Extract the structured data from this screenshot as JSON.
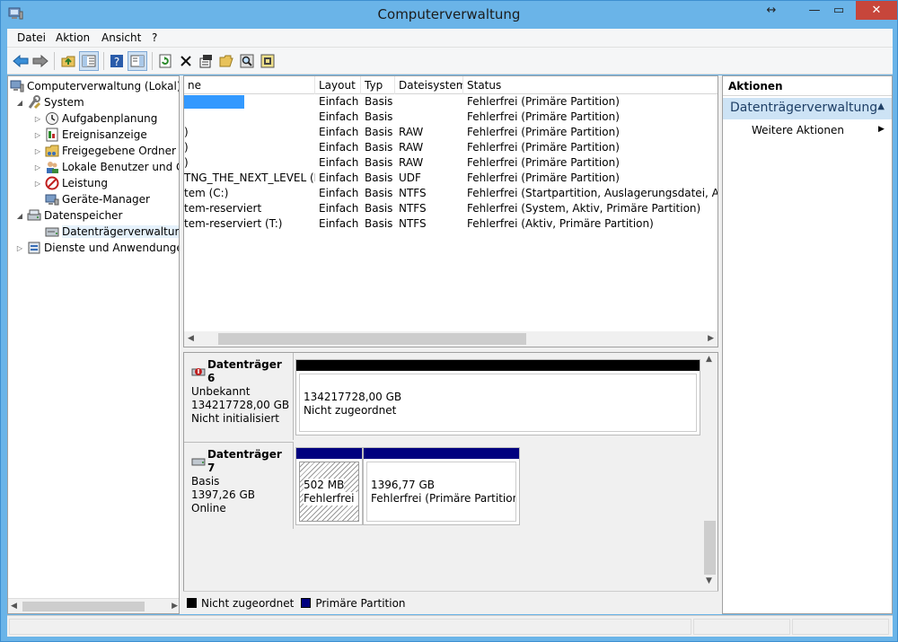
{
  "window": {
    "title": "Computerverwaltung"
  },
  "menu": [
    "Datei",
    "Aktion",
    "Ansicht",
    "?"
  ],
  "tree": {
    "root": "Computerverwaltung (Lokal)",
    "system": "System",
    "system_items": [
      "Aufgabenplanung",
      "Ereignisanzeige",
      "Freigegebene Ordner",
      "Lokale Benutzer und Gr",
      "Leistung",
      "Geräte-Manager"
    ],
    "storage": "Datenspeicher",
    "storage_items": [
      "Datenträgerverwaltung"
    ],
    "services": "Dienste und Anwendungen"
  },
  "list": {
    "columns": [
      "ne",
      "Layout",
      "Typ",
      "Dateisystem",
      "Status"
    ],
    "rows": [
      {
        "name": "",
        "layout": "Einfach",
        "type": "Basis",
        "fs": "",
        "status": "Fehlerfrei (Primäre Partition)"
      },
      {
        "name": "",
        "layout": "Einfach",
        "type": "Basis",
        "fs": "",
        "status": "Fehlerfrei (Primäre Partition)"
      },
      {
        "name": ")",
        "layout": "Einfach",
        "type": "Basis",
        "fs": "RAW",
        "status": "Fehlerfrei (Primäre Partition)"
      },
      {
        "name": ")",
        "layout": "Einfach",
        "type": "Basis",
        "fs": "RAW",
        "status": "Fehlerfrei (Primäre Partition)"
      },
      {
        "name": ")",
        "layout": "Einfach",
        "type": "Basis",
        "fs": "RAW",
        "status": "Fehlerfrei (Primäre Partition)"
      },
      {
        "name": "TNG_THE_NEXT_LEVEL (N:)",
        "layout": "Einfach",
        "type": "Basis",
        "fs": "UDF",
        "status": "Fehlerfrei (Primäre Partition)"
      },
      {
        "name": "tem (C:)",
        "layout": "Einfach",
        "type": "Basis",
        "fs": "NTFS",
        "status": "Fehlerfrei (Startpartition, Auslagerungsdatei, Absturz"
      },
      {
        "name": "tem-reserviert",
        "layout": "Einfach",
        "type": "Basis",
        "fs": "NTFS",
        "status": "Fehlerfrei (System, Aktiv, Primäre Partition)"
      },
      {
        "name": "tem-reserviert (T:)",
        "layout": "Einfach",
        "type": "Basis",
        "fs": "NTFS",
        "status": "Fehlerfrei (Aktiv, Primäre Partition)"
      }
    ]
  },
  "disks": [
    {
      "name": "Datenträger 6",
      "kind": "Unbekannt",
      "size": "134217728,00 GB",
      "state": "Nicht initialisiert",
      "volumes": [
        {
          "line1": "134217728,00 GB",
          "line2": "Nicht zugeordnet",
          "bar_color": "#000000"
        }
      ]
    },
    {
      "name": "Datenträger 7",
      "kind": "Basis",
      "size": "1397,26 GB",
      "state": "Online",
      "volumes": [
        {
          "line1": "502 MB",
          "line2": "Fehlerfrei (P",
          "bar_color": "#00007f"
        },
        {
          "line1": "1396,77 GB",
          "line2": "Fehlerfrei (Primäre Partition)",
          "bar_color": "#00007f"
        }
      ]
    }
  ],
  "legend": [
    {
      "label": "Nicht zugeordnet",
      "color": "#000000"
    },
    {
      "label": "Primäre Partition",
      "color": "#00007f"
    }
  ],
  "actions": {
    "header": "Aktionen",
    "section": "Datenträgerverwaltung",
    "more": "Weitere Aktionen"
  },
  "colors": {
    "accent": "#6ab4e8",
    "close": "#c7463b",
    "selection": "#3399ff"
  }
}
